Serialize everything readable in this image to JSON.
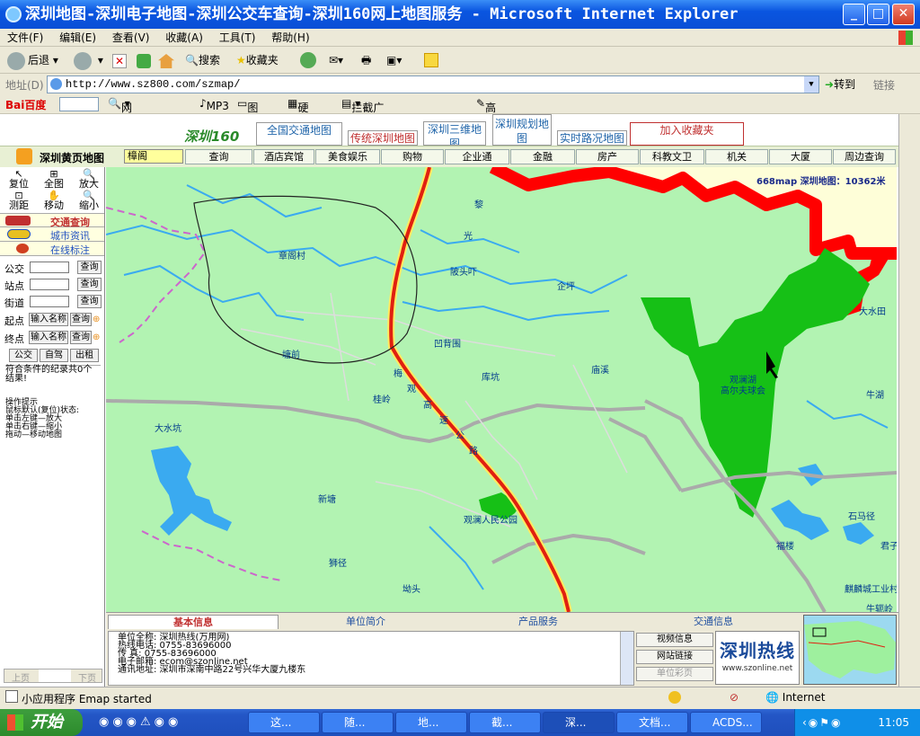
{
  "window": {
    "title": "深圳地图-深圳电子地图-深圳公交车查询-深圳160网上地图服务 - Microsoft Internet Explorer"
  },
  "menu": [
    "文件(F)",
    "编辑(E)",
    "查看(V)",
    "收藏(A)",
    "工具(T)",
    "帮助(H)"
  ],
  "toolbar": {
    "back": "后退",
    "search": "搜索",
    "favorites": "收藏夹"
  },
  "address": {
    "label": "地址(D)",
    "url": "http://www.sz800.com/szmap/",
    "go": "转到",
    "links": "链接"
  },
  "linksbar": {
    "baidu": "Bai百度",
    "websearch": "网页搜索",
    "mp3": "MP3",
    "images": "图片",
    "disk": "硬盘",
    "adblock": "拦截广告 (17537)",
    "highlight": "高亮"
  },
  "site": {
    "logo_text": "深圳160",
    "tabs": [
      "全国交通地图",
      "传统深圳地图",
      "深圳三维地图",
      "深圳规划地图",
      "实时路况地图",
      "加入收藏夹"
    ],
    "brand": "深圳黄页地图",
    "search_value": "樟阁",
    "categories": [
      "查询",
      "酒店宾馆",
      "美食娱乐",
      "购物",
      "企业通",
      "金融",
      "房产",
      "科教文卫",
      "机关",
      "大厦",
      "周边查询"
    ]
  },
  "tools": {
    "row1": [
      "复位",
      "全图",
      "放大"
    ],
    "row2": [
      "测距",
      "移动",
      "缩小"
    ],
    "menu": [
      "交通查询",
      "城市资讯",
      "在线标注"
    ],
    "query_btn": "查询",
    "fields": [
      "公交",
      "站点",
      "街道"
    ],
    "start_label": "起点",
    "end_label": "终点",
    "name_placeholder": "输入名称",
    "modes": [
      "公交",
      "自驾",
      "出租"
    ],
    "result_text": "符合条件的纪录共0个结果!",
    "help_text": "操作提示\n鼠标默认(复位)状态:\n单击左键—放大\n单击右键—缩小\n拖动—移动地图",
    "prev": "上页",
    "next": "下页"
  },
  "map": {
    "scale_text": "668map 深圳地图：10362米",
    "labels": [
      "黎",
      "光",
      "章阁村",
      "陂头吓",
      "企坪",
      "凹背围",
      "塘前",
      "梅",
      "观",
      "高",
      "速",
      "公",
      "路",
      "库坑",
      "庙溪",
      "桂岭",
      "观澜湖\n高尔夫球会",
      "大水坑",
      "新塘",
      "观澜人民公园",
      "狮径",
      "坳头",
      "大水田",
      "牛湖",
      "石马径",
      "福楼",
      "君子",
      "麒麟城工业村",
      "牛轭岭"
    ]
  },
  "bottom": {
    "tabs": [
      "基本信息",
      "单位简介",
      "产品服务",
      "交通信息"
    ],
    "info": "单位全称: 深圳热线(万用网)\n热线电话: 0755-83696000\n传    真: 0755-83696000\n电子邮箱: ecom@szonline.net\n通讯地址: 深圳市深南中路22号兴华大厦九楼东",
    "buttons": [
      "视频信息",
      "网站链接",
      "单位彩页"
    ],
    "banner": "深圳热线",
    "banner_url": "www.szonline.net"
  },
  "status": {
    "left": "小应用程序 Emap started",
    "zone": "Internet"
  },
  "taskbar": {
    "start": "开始",
    "tasks": [
      "这...",
      "随...",
      "地...",
      "截...",
      "深...",
      "文档...",
      "ACDS..."
    ],
    "time": "11:05"
  },
  "colors": {
    "accent": "#0a55e0",
    "map_bg": "#b2f3b2",
    "highway": "#e02010",
    "green_area": "#16c016",
    "water": "#3aaaf0"
  }
}
